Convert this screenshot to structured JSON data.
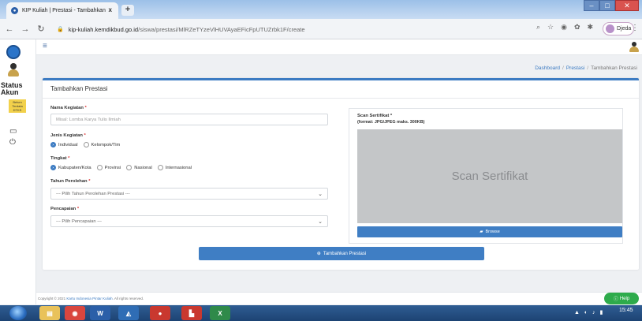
{
  "browser": {
    "tab_title": "KIP Kuliah | Prestasi - Tambahkan",
    "tab_close": "x",
    "new_tab": "+",
    "url_host": "kip-kuliah.kemdikbud.go.id",
    "url_path": "/siswa/prestasi/MlRZeTYzeVlHUVAyaEFicFpUTUZrbk1F/create",
    "profile_name": "Djeda",
    "win_min": "–",
    "win_max": "□",
    "win_close": "✕"
  },
  "sidebar": {
    "status_title": "Status Akun",
    "status_badge": "Belum Terdata DTKS"
  },
  "breadcrumb": {
    "items": [
      "Dashboard",
      "Prestasi",
      "Tambahkan Prestasi"
    ],
    "separator": "/"
  },
  "form": {
    "title": "Tambahkan Prestasi",
    "nama_kegiatan": {
      "label": "Nama Kegiatan",
      "required": "*",
      "placeholder": "Misal: Lomba Karya Tulis Ilmiah"
    },
    "jenis_kegiatan": {
      "label": "Jenis Kegiatan",
      "required": "*",
      "options": [
        "Individual",
        "Kelompok/Tim"
      ],
      "selected": "Individual"
    },
    "tingkat": {
      "label": "Tingkat",
      "required": "*",
      "options": [
        "Kabupaten/Kota",
        "Provinsi",
        "Nasional",
        "Internasional"
      ],
      "selected": "Kabupaten/Kota"
    },
    "tahun_perolehan": {
      "label": "Tahun Perolehan",
      "required": "*",
      "value": "--- Pilih Tahun Perolehan Prestasi ---"
    },
    "pencapaian": {
      "label": "Pencapaian",
      "required": "*",
      "value": "--- Pilih Pencapaian ---"
    },
    "scan": {
      "label": "Scan Sertifikat",
      "required": "*",
      "format": "(format: JPG/JPEG maks. 300KB)",
      "preview_text": "Scan Sertifikat",
      "browse_label": "Browse"
    },
    "submit_label": "Tambahkan Prestasi"
  },
  "footer": {
    "copyright_prefix": "Copyright © 2021",
    "brand": "Kartu Indonesia Pintar Kuliah",
    "suffix": ". All rights reserved."
  },
  "help_label": "Help",
  "taskbar": {
    "clock": "15:45"
  },
  "colors": {
    "primary": "#3f7ec4",
    "help_green": "#2eab4b",
    "badge_yellow": "#f2d14b"
  },
  "icons": [
    "tab-favicon",
    "back-arrow-icon",
    "forward-arrow-icon",
    "reload-icon",
    "lock-icon",
    "zoom-icon",
    "star-icon",
    "extension-icon",
    "menu-kebab-icon",
    "hamburger-icon",
    "card-icon",
    "power-icon",
    "folder-icon",
    "plus-circle-icon",
    "help-icon"
  ]
}
